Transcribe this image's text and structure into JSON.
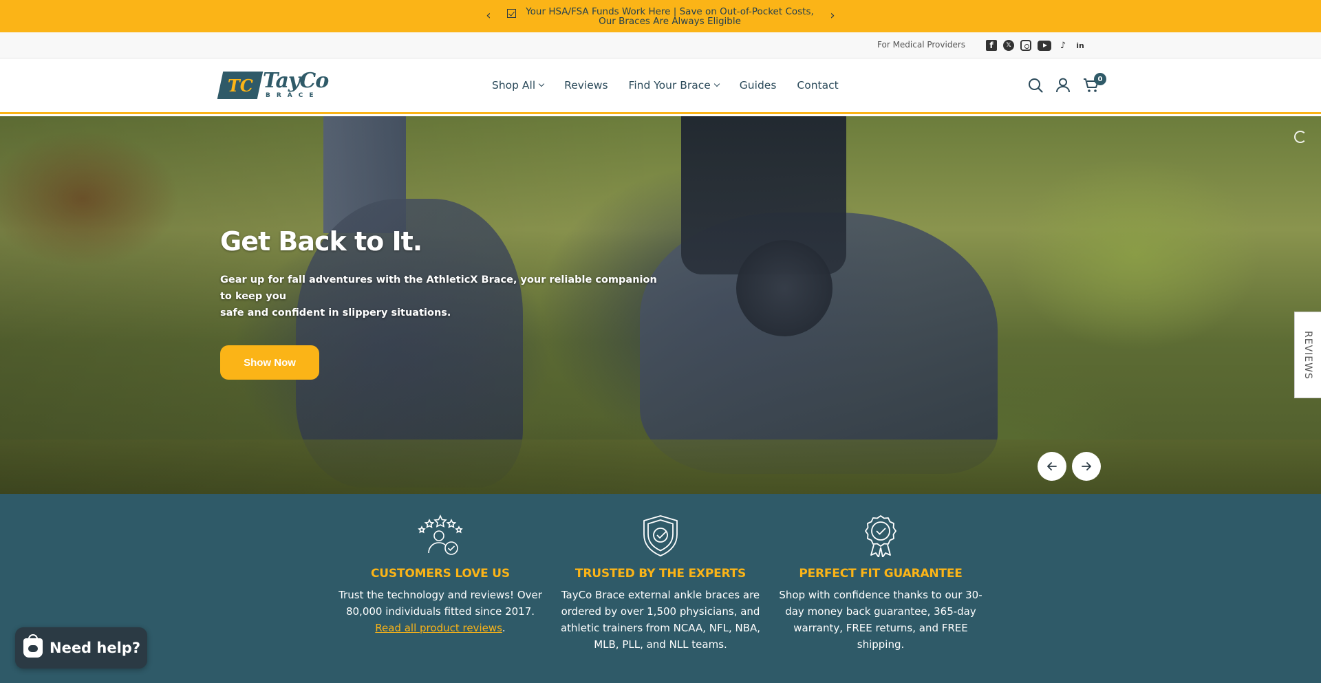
{
  "announcement": {
    "text_line1": "Your HSA/FSA Funds Work Here | Save on Out-of-Pocket Costs,",
    "text_line2": "Our Braces Are Always Eligible",
    "prev_icon": "chevron-left-icon",
    "next_icon": "chevron-right-icon",
    "bg_color": "#fbb417"
  },
  "utility": {
    "providers_link": "For Medical Providers",
    "socials": [
      "facebook-icon",
      "x-icon",
      "instagram-icon",
      "youtube-icon",
      "tiktok-icon",
      "linkedin-icon"
    ]
  },
  "header": {
    "logo_mark": "TC",
    "logo_word": "TayCo",
    "logo_sub": "BRACE",
    "nav": [
      {
        "label": "Shop All",
        "dropdown": true
      },
      {
        "label": "Reviews",
        "dropdown": false
      },
      {
        "label": "Find Your Brace",
        "dropdown": true
      },
      {
        "label": "Guides",
        "dropdown": false
      },
      {
        "label": "Contact",
        "dropdown": false
      }
    ],
    "cart_count": "0"
  },
  "hero": {
    "title": "Get Back to It.",
    "subtitle_line1": "Gear up for fall adventures with the AthleticX Brace, your reliable companion to keep you",
    "subtitle_line2": "safe and confident in slippery situations.",
    "button": "Show Now",
    "prev_icon": "arrow-left-icon",
    "next_icon": "arrow-right-icon"
  },
  "reviews_tab": "REVIEWS",
  "features": [
    {
      "icon": "customer-stars-icon",
      "title": "CUSTOMERS LOVE US",
      "text": "Trust the technology and reviews! Over 80,000 individuals fitted since 2017.",
      "link": "Read all product reviews",
      "link_suffix": "."
    },
    {
      "icon": "shield-check-icon",
      "title": "TRUSTED BY THE EXPERTS",
      "text": "TayCo Brace external ankle braces are ordered by over 1,500 physicians, and athletic trainers from NCAA, NFL, NBA, MLB, PLL, and NLL teams."
    },
    {
      "icon": "award-badge-icon",
      "title": "PERFECT FIT GUARANTEE",
      "text": "Shop with confidence thanks to our 30-day money back guarantee, 365-day warranty, FREE returns, and FREE shipping."
    }
  ],
  "chat": {
    "label": "Need help?",
    "icon": "shopify-chat-icon"
  },
  "colors": {
    "accent": "#fbb417",
    "brand": "#2f5a68",
    "dark": "#2b3a44"
  }
}
